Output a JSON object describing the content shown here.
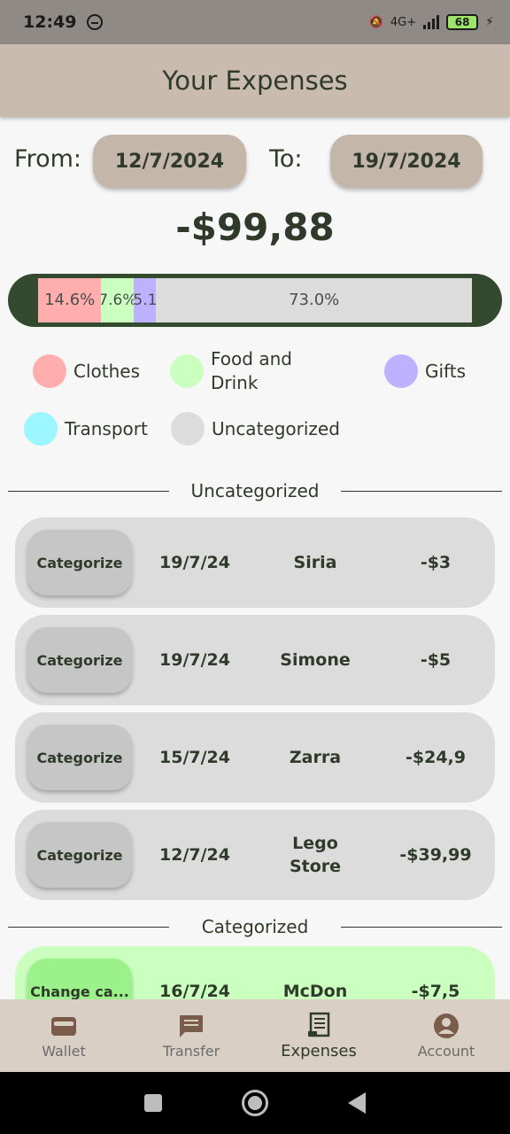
{
  "status_bar": {
    "time": "12:49",
    "network": "4G+",
    "battery": "68"
  },
  "header": {
    "title": "Your Expenses"
  },
  "date_range": {
    "from_label": "From:",
    "from_value": "12/7/2024",
    "to_label": "To:",
    "to_value": "19/7/2024"
  },
  "total": "-$99,88",
  "breakdown": [
    {
      "category": "Clothes",
      "percent_label": "14.6%",
      "fraction": 0.146,
      "color": "#ffadad"
    },
    {
      "category": "Food and Drink",
      "percent_label": "7.6%",
      "fraction": 0.076,
      "color": "#caffbf"
    },
    {
      "category": "Gifts",
      "percent_label": "5.1",
      "fraction": 0.051,
      "color": "#bdb2ff"
    },
    {
      "category": "Uncategorized",
      "percent_label": "73.0%",
      "fraction": 0.73,
      "color": "#dcdcdc"
    }
  ],
  "legend": [
    {
      "label": "Clothes",
      "color": "#ffadad"
    },
    {
      "label": "Food and Drink",
      "color": "#caffbf"
    },
    {
      "label": "Gifts",
      "color": "#bdb2ff"
    },
    {
      "label": "Transport",
      "color": "#9bf6ff"
    },
    {
      "label": "Uncategorized",
      "color": "#dcdcdc"
    }
  ],
  "sections": {
    "uncategorized_title": "Uncategorized",
    "categorized_title": "Categorized"
  },
  "uncategorized": [
    {
      "button": "Categorize",
      "date": "19/7/24",
      "name": "Siria",
      "amount": "-$3"
    },
    {
      "button": "Categorize",
      "date": "19/7/24",
      "name": "Simone",
      "amount": "-$5"
    },
    {
      "button": "Categorize",
      "date": "15/7/24",
      "name": "Zarra",
      "amount": "-$24,9"
    },
    {
      "button": "Categorize",
      "date": "12/7/24",
      "name": "Lego Store",
      "amount": "-$39,99"
    }
  ],
  "categorized": [
    {
      "button": "Change ca...",
      "date": "16/7/24",
      "name": "McDon",
      "amount": "-$7,5",
      "color": "#caffbf"
    }
  ],
  "nav": [
    {
      "label": "Wallet",
      "icon": "wallet-icon"
    },
    {
      "label": "Transfer",
      "icon": "chat-icon"
    },
    {
      "label": "Expenses",
      "icon": "receipt-icon",
      "active": true
    },
    {
      "label": "Account",
      "icon": "account-icon"
    }
  ]
}
